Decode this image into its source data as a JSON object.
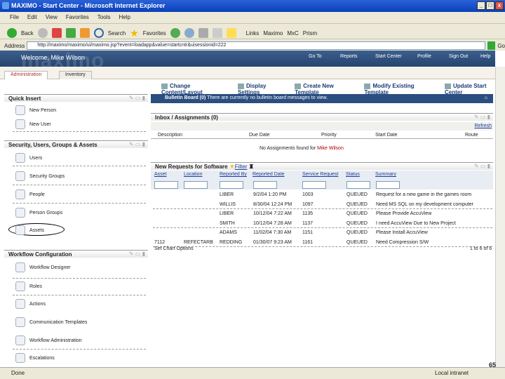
{
  "window": {
    "title": "MAXIMO - Start Center - Microsoft Internet Explorer"
  },
  "menu": [
    "File",
    "Edit",
    "View",
    "Favorites",
    "Tools",
    "Help"
  ],
  "toolbar": {
    "back": "Back",
    "search": "Search",
    "favorites": "Favorites",
    "links_label": "Links",
    "links": [
      "Maximo",
      "MxC",
      "Prism"
    ]
  },
  "address": {
    "label": "Address",
    "url": "http://maximo/maximo/ui/maximo.jsp?event=loadapp&value=startcntr&uisessionid=222",
    "go": "Go"
  },
  "header": {
    "logo": "maximo",
    "welcome": "Welcome, Mike Wilson",
    "links": [
      "Go To",
      "Reports",
      "Start Center",
      "Profile",
      "Sign Out",
      "Help"
    ]
  },
  "tabs": [
    "Administration",
    "Inventory"
  ],
  "actions": [
    "Change Content/Layout",
    "Display Settings",
    "Create New Template",
    "Modify Existing Template",
    "Update Start Center"
  ],
  "bulletin": {
    "title": "Bulletin Board (0)",
    "message": "There are currently no bulletin board messages to view."
  },
  "left": {
    "quick_insert": {
      "title": "Quick Insert",
      "items": [
        "New Person",
        "New User"
      ]
    },
    "security": {
      "title": "Security, Users, Groups & Assets",
      "items": [
        "Users",
        "Security Groups",
        "People",
        "Person Groups",
        "Assets"
      ]
    },
    "workflow": {
      "title": "Workflow Configuration",
      "items": [
        "Workflow Designer",
        "Roles",
        "Actions",
        "Communication Templates",
        "Workflow Administration",
        "Escalations"
      ]
    }
  },
  "inbox": {
    "title": "Inbox / Assignments (0)",
    "refresh": "Refresh",
    "columns": [
      "Description",
      "Due Date",
      "Priority",
      "Start Date",
      "Route"
    ],
    "empty_prefix": "No Assignments found for",
    "empty_user": "Mike Wilson"
  },
  "requests": {
    "title": "New Requests for Software",
    "filter": "Filter",
    "columns": [
      "Asset",
      "Location",
      "Reported By",
      "Reported Date",
      "Service Request",
      "Status",
      "Summary"
    ],
    "rows": [
      [
        "",
        "",
        "LIBER",
        "9/2/04 1:20 PM",
        "1003",
        "QUEUED",
        "Request for a new game in the games room"
      ],
      [
        "",
        "",
        "WILLIS",
        "8/30/04 12:24 PM",
        "1097",
        "QUEUED",
        "Need MS SQL on my development computer"
      ],
      [
        "",
        "",
        "LIBER",
        "10/12/04 7:22 AM",
        "1135",
        "QUEUED",
        "Please Provide AccuView"
      ],
      [
        "",
        "",
        "SMITH",
        "10/12/04 7:28 AM",
        "1137",
        "QUEUED",
        "I need AccuView Due to New Project"
      ],
      [
        "",
        "",
        "ADAMS",
        "11/02/04 7:30 AM",
        "1151",
        "QUEUED",
        "Please Install AccuView"
      ],
      [
        "7112",
        "REFECTARB",
        "REDDING",
        "01/30/07 9:23 AM",
        "1161",
        "QUEUED",
        "Need Compression S/W"
      ]
    ],
    "options": "Set Chart Options",
    "count": "1 to 6 of 6"
  },
  "status": {
    "text": "Done",
    "zone": "Local intranet",
    "page": "65"
  }
}
